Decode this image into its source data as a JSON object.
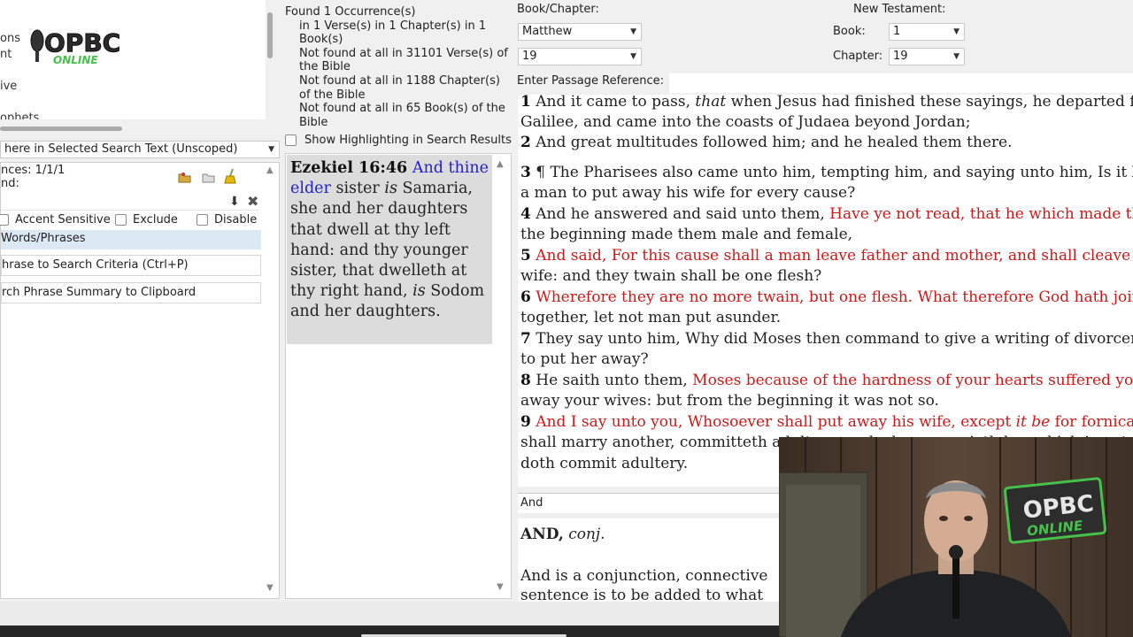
{
  "left_panel": {
    "cut_labels": [
      "ons",
      "nt",
      "ive",
      "ophets"
    ],
    "scope_select": "here in Selected Search Text (Unscoped)",
    "occurrences_label": "nces: 1/1/1",
    "found_label": "nd:",
    "checkboxes": [
      {
        "label": "Accent Sensitive",
        "checked": false
      },
      {
        "label": "Exclude",
        "checked": false
      },
      {
        "label": "Disable",
        "checked": false
      }
    ],
    "words_phrases_label": "Words/Phrases",
    "add_phrase_button": "hrase to Search Criteria (Ctrl+P)",
    "copy_summary_button": "rch Phrase Summary to Clipboard"
  },
  "search_summary": {
    "found_line": "Found 1 Occurrence(s)",
    "in_line": "in 1 Verse(s) in 1 Chapter(s) in 1 Book(s)",
    "nf_verses": "Not found at all in 31101 Verse(s) of the Bible",
    "nf_chapters": "Not found at all in 1188 Chapter(s) of the Bible",
    "nf_books": "Not found at all in 65 Book(s) of the Bible",
    "show_highlighting_label": "Show Highlighting in Search Results"
  },
  "search_result": {
    "reference": "Ezekiel 16:46",
    "text_blue": "And thine elder",
    "text_1": "sister",
    "text_italic_1": "is",
    "text_2": "Samaria, she and her daughters that dwell at thy left hand: and thy younger sister, that dwelleth at thy right hand,",
    "text_italic_2": "is",
    "text_3": "Sodom and her daughters."
  },
  "navigation": {
    "book_chapter_label": "Book/Chapter:",
    "book_value": "Matthew",
    "chapter_value": "19",
    "new_testament_label": "New Testament:",
    "nt_book_label": "Book:",
    "nt_book_value": "1",
    "nt_chapter_label": "Chapter:",
    "nt_chapter_value": "19",
    "passage_label": "Enter Passage Reference:"
  },
  "verses": {
    "v1": {
      "num": "1",
      "a": "And it came to pass,",
      "i": "that",
      "b": "when Jesus had finished these sayings, he departed from"
    },
    "v1b": "Galilee, and came into the coasts of Judaea beyond Jordan;",
    "v2": {
      "num": "2",
      "text": "And great multitudes followed him; and he healed them there."
    },
    "v3": {
      "num": "3",
      "text": "¶ The Pharisees also came unto him, tempting him, and saying unto him, Is it lawful for"
    },
    "v3b": "a man to put away his wife for every cause?",
    "v4": {
      "num": "4",
      "text": "And he answered and said unto them,",
      "red": "Have ye not read, that he which made them at"
    },
    "v4b_red": "the beginning made them male and female,",
    "v5": {
      "num": "5",
      "red": "And said, For this cause shall a man leave father and mother, and shall cleave to his"
    },
    "v5b_red": "wife: and they twain shall be one flesh?",
    "v6": {
      "num": "6",
      "red": "Wherefore they are no more twain, but one flesh. What therefore God hath joined"
    },
    "v6b_red": "together, let not man put asunder.",
    "v7": {
      "num": "7",
      "text": "They say unto him, Why did Moses then command to give a writing of divorcement, and"
    },
    "v7b": "to put her away?",
    "v8": {
      "num": "8",
      "text": "He saith unto them,",
      "red": "Moses because of the hardness of your hearts suffered you to put"
    },
    "v8b_red": "away your wives: but from the beginning it was not so.",
    "v9": {
      "num": "9",
      "red_a": "And I say unto you, Whosoever shall put away his wife, except",
      "red_i": "it be",
      "red_b": "for fornication, and"
    },
    "v9b_red": "shall marry another, committeth adultery: and whoso marrieth her which is put away",
    "v9c_red": "doth commit adultery."
  },
  "dictionary": {
    "word_label": "And",
    "headword": "AND,",
    "pos": "conj.",
    "body_1": "And is a conjunction, connective",
    "body_2": "sentence is to be added to what"
  },
  "webcam": {
    "sign_line1": "OPBC",
    "sign_line2": "ONLINE"
  },
  "logo": {
    "line1": "OPBC",
    "line2": "ONLINE"
  },
  "colors": {
    "accent_red": "#cc1a1a",
    "link_blue": "#2222cc",
    "logo_green": "#46c24b"
  }
}
